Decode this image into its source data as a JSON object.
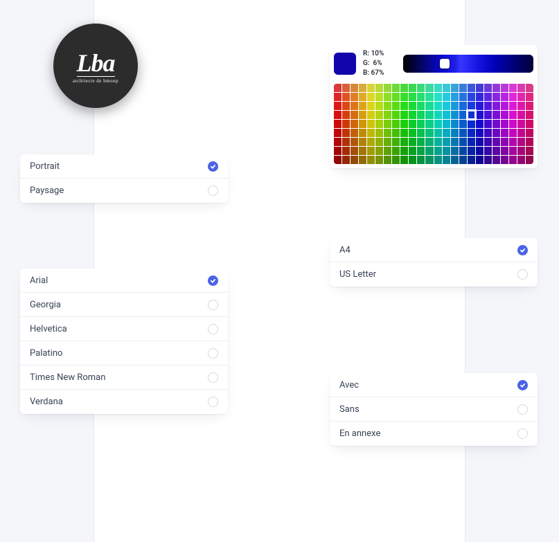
{
  "logo": {
    "main": "Lba",
    "sub": "architecte de hmonp"
  },
  "orientation": {
    "items": [
      {
        "label": "Portrait",
        "selected": true
      },
      {
        "label": "Paysage",
        "selected": false
      }
    ]
  },
  "fonts": {
    "items": [
      {
        "label": "Arial",
        "selected": true
      },
      {
        "label": "Georgia",
        "selected": false
      },
      {
        "label": "Helvetica",
        "selected": false
      },
      {
        "label": "Palatino",
        "selected": false
      },
      {
        "label": "Times New Roman",
        "selected": false
      },
      {
        "label": "Verdana",
        "selected": false
      }
    ]
  },
  "paper": {
    "items": [
      {
        "label": "A4",
        "selected": true
      },
      {
        "label": "US Letter",
        "selected": false
      }
    ]
  },
  "summary": {
    "items": [
      {
        "label": "Avec",
        "selected": true
      },
      {
        "label": "Sans",
        "selected": false
      },
      {
        "label": "En annexe",
        "selected": false
      }
    ]
  },
  "color": {
    "swatch": "#1106ab",
    "readout": "R: 10%\nG:  6%\nB: 67%",
    "grid_cols": 24,
    "grid_rows": 9,
    "picked": {
      "row": 3,
      "col": 16
    }
  }
}
